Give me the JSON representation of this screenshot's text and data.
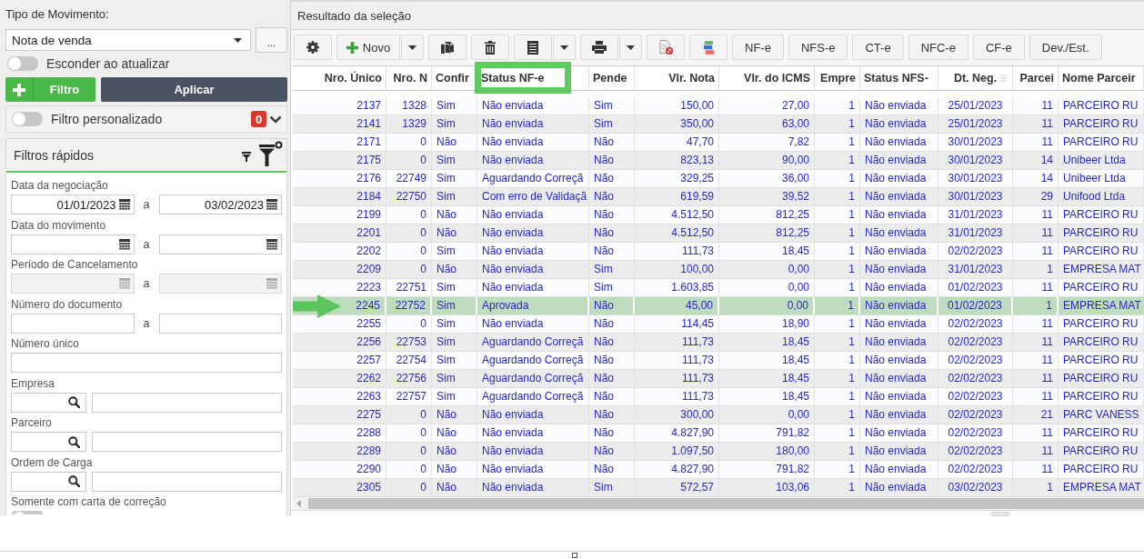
{
  "filter_panel": {
    "movement_type": {
      "label": "Tipo de Movimento:",
      "value": "Nota de venda",
      "more_button": "..."
    },
    "hide_on_update": {
      "label": "Esconder ao atualizar",
      "on": false
    },
    "buttons": [
      {
        "kind": "add",
        "label": "Filtro"
      },
      {
        "kind": "apply",
        "label": "Aplicar"
      }
    ],
    "custom_filter": {
      "label": "Filtro personalizado",
      "on": false,
      "count": "0",
      "expanded": false
    },
    "quick_filters": {
      "title": "Filtros rápidos",
      "fields": [
        {
          "kind": "date_range",
          "label": "Data da negociação",
          "from": "01/01/2023",
          "to": "03/02/2023",
          "separator": "a",
          "disabled": false
        },
        {
          "kind": "date_range",
          "label": "Data do movimento",
          "separator": "a",
          "disabled": false
        },
        {
          "kind": "date_range",
          "label": "Período de Cancelamento",
          "separator": "a",
          "disabled": true
        },
        {
          "kind": "range",
          "label": "Número do documento",
          "separator": "a",
          "disabled": false
        },
        {
          "kind": "text",
          "label": "Número único",
          "disabled": false
        },
        {
          "kind": "lookup",
          "label": "Empresa",
          "disabled": false
        },
        {
          "kind": "lookup",
          "label": "Parceiro",
          "disabled": false
        },
        {
          "kind": "lookup",
          "label": "Ordem de Carga",
          "disabled": false
        },
        {
          "kind": "toggle",
          "label": "Somente com carta de correção",
          "on": false,
          "disabled": false
        }
      ]
    }
  },
  "results": {
    "title": "Resultado da seleção",
    "toolbar": [
      {
        "kind": "settings",
        "split": false
      },
      {
        "kind": "add",
        "label": "Novo",
        "split": true
      },
      {
        "kind": "copy",
        "split": false
      },
      {
        "kind": "delete",
        "split": false
      },
      {
        "kind": "list",
        "split": true
      },
      {
        "kind": "print",
        "split": true
      },
      {
        "kind": "reject",
        "split": false
      },
      {
        "kind": "layers",
        "split": false
      },
      {
        "kind": "text",
        "label": "NF-e",
        "split": false
      },
      {
        "kind": "text",
        "label": "NFS-e",
        "split": false
      },
      {
        "kind": "text",
        "label": "CT-e",
        "split": false
      },
      {
        "kind": "text",
        "label": "NFC-e",
        "split": false
      },
      {
        "kind": "text",
        "label": "CF-e",
        "split": false
      },
      {
        "kind": "text",
        "label": "Dev./Est.",
        "split": false
      }
    ],
    "columns": [
      {
        "label": "Nro. Único",
        "kind": "number",
        "highlighted": false,
        "menu": false
      },
      {
        "label": "Nro. N",
        "kind": "number",
        "highlighted": false,
        "menu": false
      },
      {
        "label": "Confir",
        "kind": "text",
        "highlighted": false,
        "menu": false
      },
      {
        "label": "Status NF-e",
        "kind": "text",
        "highlighted": true,
        "menu": false
      },
      {
        "label": "Pende",
        "kind": "text",
        "highlighted": false,
        "menu": false
      },
      {
        "label": "Vlr. Nota",
        "kind": "number",
        "highlighted": false,
        "menu": false
      },
      {
        "label": "Vlr. do ICMS",
        "kind": "number",
        "highlighted": false,
        "menu": false
      },
      {
        "label": "Empre",
        "kind": "number",
        "highlighted": false,
        "menu": false
      },
      {
        "label": "Status NFS-",
        "kind": "text",
        "highlighted": false,
        "menu": false
      },
      {
        "label": "Dt. Neg.",
        "kind": "date",
        "highlighted": false,
        "menu": true
      },
      {
        "label": "Parcei",
        "kind": "number",
        "highlighted": false,
        "menu": false
      },
      {
        "label": "Nome Parceir",
        "kind": "text",
        "highlighted": false,
        "menu": false
      }
    ],
    "rows": [
      {
        "selected": false,
        "cells": [
          "2137",
          "1328",
          "Sim",
          "Não enviada",
          "Sim",
          "150,00",
          "27,00",
          "1",
          "Não enviada",
          "25/01/2023",
          "11",
          "PARCEIRO RU"
        ]
      },
      {
        "selected": false,
        "cells": [
          "2141",
          "1329",
          "Sim",
          "Não enviada",
          "Sim",
          "350,00",
          "63,00",
          "1",
          "Não enviada",
          "25/01/2023",
          "11",
          "PARCEIRO RU"
        ]
      },
      {
        "selected": false,
        "cells": [
          "2171",
          "0",
          "Não",
          "Não enviada",
          "Não",
          "47,70",
          "7,82",
          "1",
          "Não enviada",
          "30/01/2023",
          "11",
          "PARCEIRO RU"
        ]
      },
      {
        "selected": false,
        "cells": [
          "2175",
          "0",
          "Sim",
          "Não enviada",
          "Não",
          "823,13",
          "90,00",
          "1",
          "Não enviada",
          "30/01/2023",
          "14",
          "Unibeer Ltda"
        ]
      },
      {
        "selected": false,
        "cells": [
          "2176",
          "22749",
          "Sim",
          "Aguardando Correçã",
          "Não",
          "329,25",
          "36,00",
          "1",
          "Não enviada",
          "30/01/2023",
          "14",
          "Unibeer Ltda"
        ]
      },
      {
        "selected": false,
        "cells": [
          "2184",
          "22750",
          "Sim",
          "Com erro de Validaçã",
          "Não",
          "619,59",
          "39,52",
          "1",
          "Não enviada",
          "30/01/2023",
          "29",
          "Unifood Ltda"
        ]
      },
      {
        "selected": false,
        "cells": [
          "2199",
          "0",
          "Não",
          "Não enviada",
          "Não",
          "4.512,50",
          "812,25",
          "1",
          "Não enviada",
          "31/01/2023",
          "11",
          "PARCEIRO RU"
        ]
      },
      {
        "selected": false,
        "cells": [
          "2201",
          "0",
          "Não",
          "Não enviada",
          "Não",
          "4.512,50",
          "812,25",
          "1",
          "Não enviada",
          "31/01/2023",
          "11",
          "PARCEIRO RU"
        ]
      },
      {
        "selected": false,
        "cells": [
          "2202",
          "0",
          "Sim",
          "Não enviada",
          "Não",
          "111,73",
          "18,45",
          "1",
          "Não enviada",
          "02/02/2023",
          "11",
          "PARCEIRO RU"
        ]
      },
      {
        "selected": false,
        "cells": [
          "2209",
          "0",
          "Não",
          "Não enviada",
          "Sim",
          "100,00",
          "0,00",
          "1",
          "Não enviada",
          "31/01/2023",
          "1",
          "EMPRESA MAT"
        ]
      },
      {
        "selected": false,
        "cells": [
          "2223",
          "22751",
          "Sim",
          "Não enviada",
          "Sim",
          "1.603,85",
          "0,00",
          "1",
          "Não enviada",
          "01/02/2023",
          "11",
          "PARCEIRO RU"
        ]
      },
      {
        "selected": true,
        "cells": [
          "2245",
          "22752",
          "Sim",
          "Aprovada",
          "Não",
          "45,00",
          "0,00",
          "1",
          "Não enviada",
          "01/02/2023",
          "1",
          "EMPRESA MAT"
        ]
      },
      {
        "selected": false,
        "cells": [
          "2255",
          "0",
          "Sim",
          "Não enviada",
          "Não",
          "114,45",
          "18,90",
          "1",
          "Não enviada",
          "02/02/2023",
          "11",
          "PARCEIRO RU"
        ]
      },
      {
        "selected": false,
        "cells": [
          "2256",
          "22753",
          "Sim",
          "Aguardando Correçã",
          "Não",
          "111,73",
          "18,45",
          "1",
          "Não enviada",
          "02/02/2023",
          "11",
          "PARCEIRO RU"
        ]
      },
      {
        "selected": false,
        "cells": [
          "2257",
          "22754",
          "Sim",
          "Aguardando Correçã",
          "Não",
          "111,73",
          "18,45",
          "1",
          "Não enviada",
          "02/02/2023",
          "11",
          "PARCEIRO RU"
        ]
      },
      {
        "selected": false,
        "cells": [
          "2262",
          "22756",
          "Sim",
          "Aguardando Correçã",
          "Não",
          "111,73",
          "18,45",
          "1",
          "Não enviada",
          "02/02/2023",
          "11",
          "PARCEIRO RU"
        ]
      },
      {
        "selected": false,
        "cells": [
          "2263",
          "22757",
          "Sim",
          "Aguardando Correçã",
          "Não",
          "111,73",
          "18,45",
          "1",
          "Não enviada",
          "02/02/2023",
          "11",
          "PARCEIRO RU"
        ]
      },
      {
        "selected": false,
        "cells": [
          "2275",
          "0",
          "Não",
          "Não enviada",
          "Não",
          "300,00",
          "0,00",
          "1",
          "Não enviada",
          "02/02/2023",
          "21",
          "PARC VANESS"
        ]
      },
      {
        "selected": false,
        "cells": [
          "2288",
          "0",
          "Não",
          "Não enviada",
          "Não",
          "4.827,90",
          "791,82",
          "1",
          "Não enviada",
          "02/02/2023",
          "11",
          "PARCEIRO RU"
        ]
      },
      {
        "selected": false,
        "cells": [
          "2289",
          "0",
          "Não",
          "Não enviada",
          "Não",
          "1.097,50",
          "180,00",
          "1",
          "Não enviada",
          "02/02/2023",
          "11",
          "PARCEIRO RU"
        ]
      },
      {
        "selected": false,
        "cells": [
          "2290",
          "0",
          "Não",
          "Não enviada",
          "Não",
          "4.827,90",
          "791,82",
          "1",
          "Não enviada",
          "02/02/2023",
          "11",
          "PARCEIRO RU"
        ]
      },
      {
        "selected": false,
        "cells": [
          "2305",
          "0",
          "Não",
          "Não enviada",
          "Sim",
          "572,57",
          "103,06",
          "1",
          "Não enviada",
          "03/02/2023",
          "1",
          "EMPRESA MAT"
        ]
      }
    ]
  }
}
